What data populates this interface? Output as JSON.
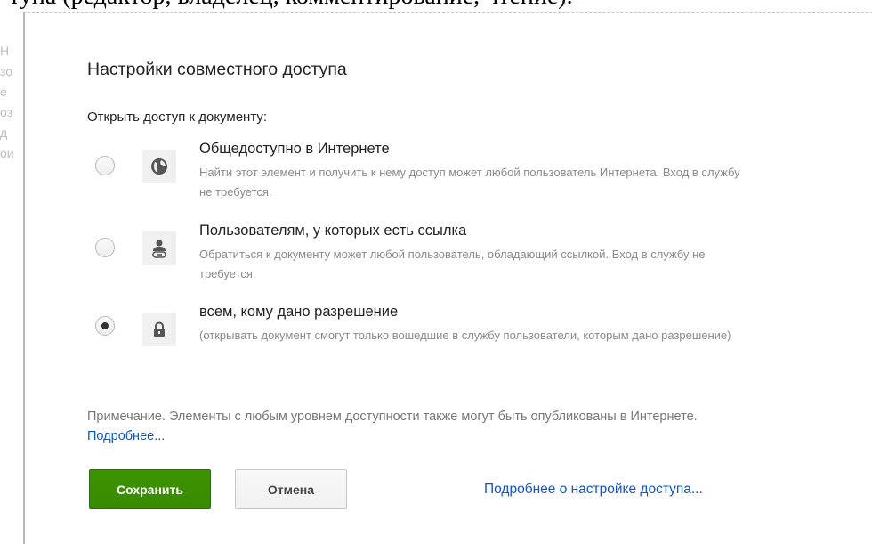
{
  "background": {
    "heading_text": "тупа (редактор, владелец, комментирование, чтение).",
    "side_fragments": [
      "Н",
      "зо",
      "е",
      "оз",
      "д",
      "ои"
    ]
  },
  "dialog": {
    "title": "Настройки совместного доступа",
    "section_label": "Открыть доступ к документу:",
    "options": [
      {
        "title": "Общедоступно в Интернете",
        "description": "Найти этот элемент и получить к нему доступ может любой пользователь Интернета. Вход в службу не требуется.",
        "icon": "globe-icon",
        "selected": false
      },
      {
        "title": "Пользователям, у которых есть ссылка",
        "description": "Обратиться к документу может любой пользователь, обладающий ссылкой. Вход в службу не требуется.",
        "icon": "person-link-icon",
        "selected": false
      },
      {
        "title": "всем, кому дано разрешение",
        "description": "(открывать документ смогут только вошедшие в службу пользователи, которым дано разрешение)",
        "icon": "lock-icon",
        "selected": true
      }
    ],
    "note": {
      "text": "Примечание. Элементы с любым уровнем доступности также могут быть опубликованы в Интернете.",
      "link": "Подробнее..."
    },
    "buttons": {
      "save": "Сохранить",
      "cancel": "Отмена"
    },
    "access_link": "Подробнее о настройке доступа..."
  },
  "colors": {
    "save_button": "#3d9400",
    "link": "#1155cc",
    "description_text": "#8a8a8a"
  }
}
